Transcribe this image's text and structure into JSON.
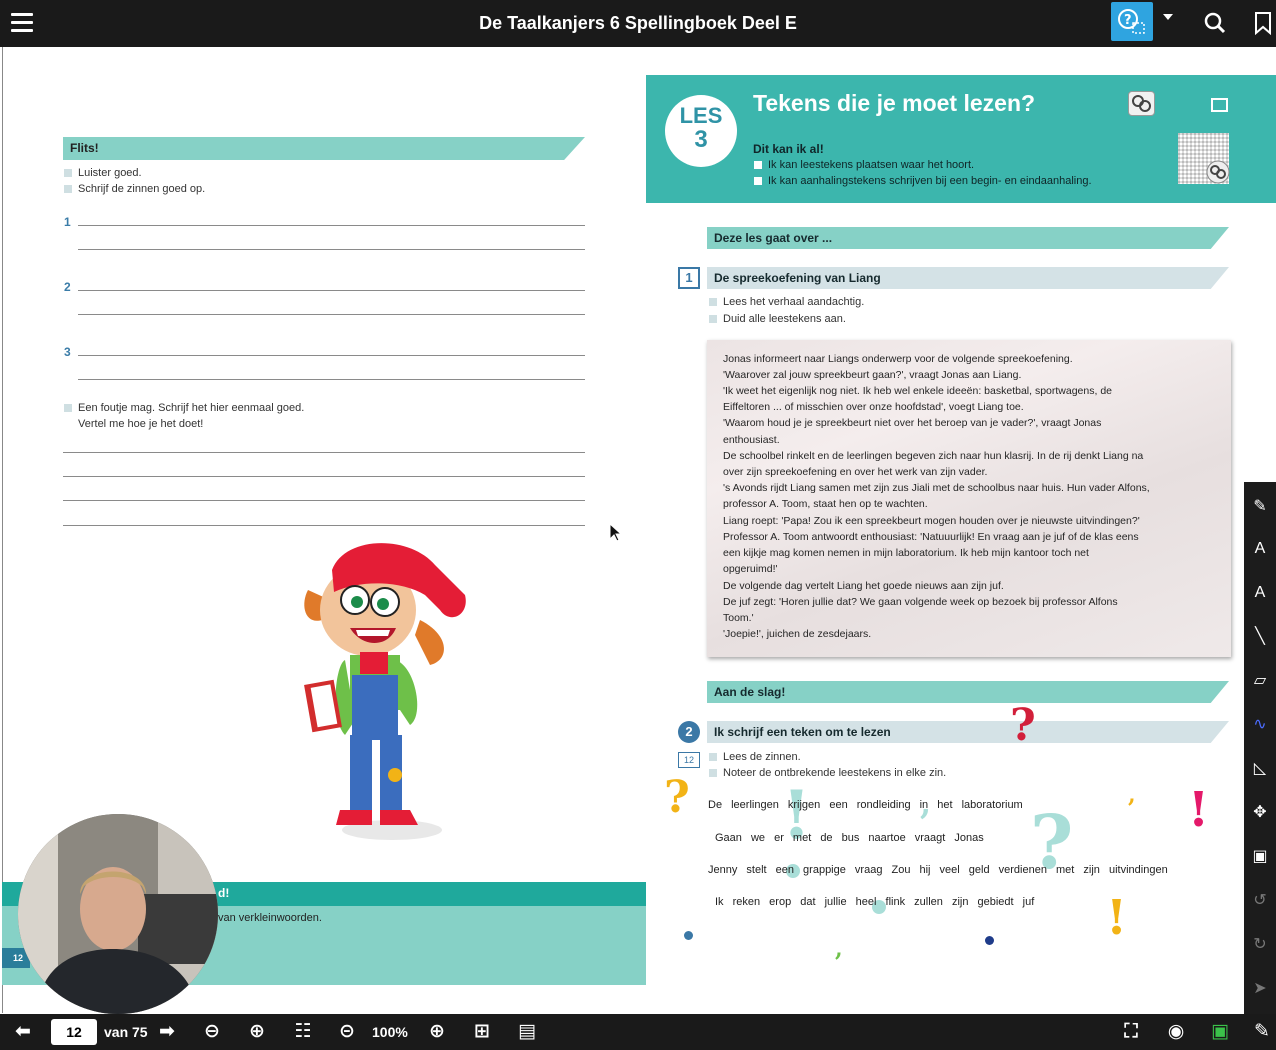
{
  "app": {
    "title": "De Taalkanjers 6 Spellingboek Deel E"
  },
  "left_page": {
    "flits_label": "Flits!",
    "bullets": [
      "Luister goed.",
      "Schrijf de zinnen goed op."
    ],
    "line_numbers": [
      "1",
      "2",
      "3"
    ],
    "extra_bullet_1": "Een foutje mag. Schrijf het hier eenmaal goed.",
    "extra_bullet_2": "Vertel me hoe je het doet!",
    "footer_label": "d!",
    "footer_text": "van verkleinwoorden.",
    "page_number": "12"
  },
  "right_page": {
    "les_label": "LES",
    "les_number": "3",
    "title": "Tekens die je moet lezen?",
    "dit_kan_ik": "Dit kan ik al!",
    "goals": [
      "Ik kan leestekens plaatsen waar het hoort.",
      "Ik kan aanhalingstekens schrijven bij een begin- en eindaanhaling."
    ],
    "deze_les": "Deze les gaat over ...",
    "ex1_number": "1",
    "ex1_title": "De spreekoefening van Liang",
    "ex1_bullets": [
      "Lees het verhaal aandachtig.",
      "Duid alle leestekens aan."
    ],
    "story_lines": [
      "Jonas informeert naar Liangs onderwerp voor de volgende spreekoefening.",
      "'Waarover zal jouw spreekbeurt gaan?', vraagt Jonas aan Liang.",
      "'Ik weet het eigenlijk nog niet. Ik heb wel enkele ideeën: basketbal, sportwagens, de",
      "Eiffeltoren ... of misschien over onze hoofdstad', voegt Liang toe.",
      "'Waarom houd je je spreekbeurt niet over het beroep van je vader?', vraagt Jonas",
      "enthousiast.",
      "De schoolbel rinkelt en de leerlingen begeven zich naar hun klasrij. In de rij denkt Liang na",
      "over zijn spreekoefening en over het werk van zijn vader.",
      "'s Avonds rijdt Liang samen met zijn zus Jiali met de schoolbus naar huis. Hun vader Alfons,",
      "professor A. Toom, staat hen op te wachten.",
      "Liang roept: 'Papa! Zou ik een spreekbeurt mogen houden over je nieuwste uitvindingen?'",
      "Professor A. Toom antwoordt enthousiast: 'Natuuurlijk! En vraag aan je juf of de klas eens",
      "een kijkje mag komen nemen in mijn laboratorium. Ik heb mijn kantoor toch net",
      "opgeruimd!'",
      "De volgende dag vertelt Liang het goede nieuws aan zijn juf.",
      "De juf zegt: 'Horen jullie dat? We gaan volgende week op bezoek bij professor Alfons",
      "Toom.'",
      "'Joepie!', juichen de zesdejaars."
    ],
    "aan_de_slag": "Aan de slag!",
    "ex2_number": "2",
    "ex2_ref": "12",
    "ex2_title": "Ik schrijf een teken om te lezen",
    "ex2_bullets": [
      "Lees de zinnen.",
      "Noteer de ontbrekende leestekens in elke zin."
    ],
    "sentences": [
      "De leerlingen krijgen een rondleiding in het laboratorium",
      "Gaan we er met de bus naartoe vraagt Jonas",
      "Jenny stelt een grappige vraag Zou hij veel geld verdienen met zijn uitvindingen",
      "Ik reken erop dat jullie heel flink zullen zijn gebiedt juf"
    ]
  },
  "bottom": {
    "page_input": "12",
    "page_total": "van 75",
    "zoom": "100%"
  },
  "icons": {
    "menu": "hamburger-icon",
    "help": "help-select-icon",
    "search": "search-icon",
    "bookmark": "bookmark-icon"
  },
  "colors": {
    "teal_header": "#3cb6ad",
    "teal_bar": "#86d1c6",
    "grey_bar": "#d4e2e6",
    "accent_blue": "#2fa4e0",
    "punct_red": "#d21f3a",
    "punct_yellow": "#f2b316",
    "punct_cyan": "#a9ded8"
  }
}
